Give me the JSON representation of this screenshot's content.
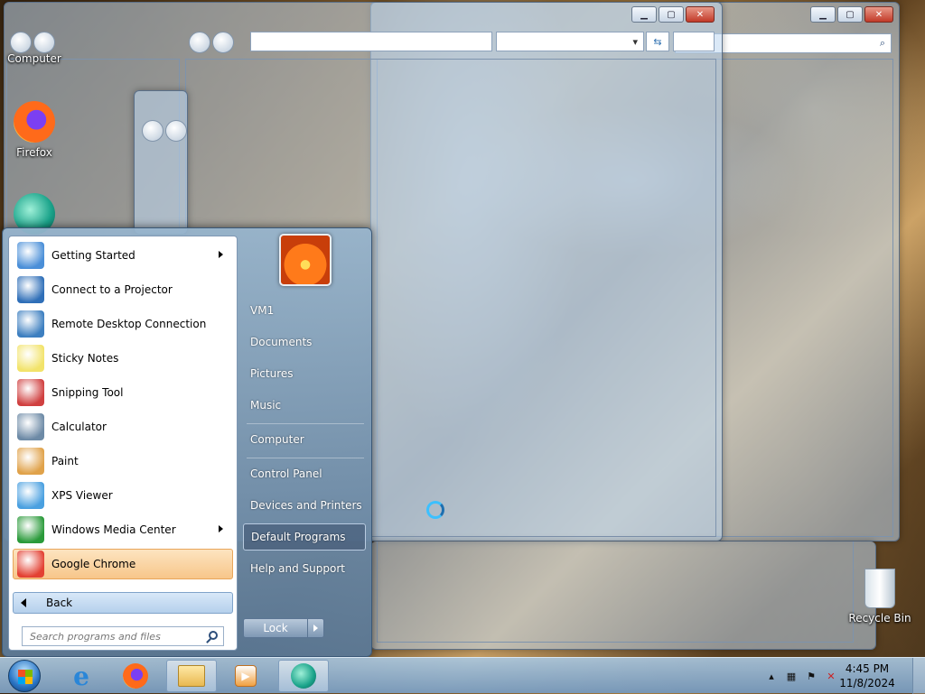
{
  "desktop": {
    "icons": [
      {
        "label": "Computer"
      },
      {
        "label": "Firefox"
      },
      {
        "label": "Recycle Bin"
      }
    ]
  },
  "start_menu": {
    "programs": [
      {
        "label": "Getting Started",
        "has_submenu": true,
        "icon": "getting-started-icon",
        "color": "#4a8fd8"
      },
      {
        "label": "Connect to a Projector",
        "has_submenu": false,
        "icon": "projector-icon",
        "color": "#2f6fb8"
      },
      {
        "label": "Remote Desktop Connection",
        "has_submenu": false,
        "icon": "remote-desktop-icon",
        "color": "#3d7fc0"
      },
      {
        "label": "Sticky Notes",
        "has_submenu": false,
        "icon": "sticky-notes-icon",
        "color": "#f2e36a"
      },
      {
        "label": "Snipping Tool",
        "has_submenu": false,
        "icon": "scissors-icon",
        "color": "#d04040"
      },
      {
        "label": "Calculator",
        "has_submenu": false,
        "icon": "calculator-icon",
        "color": "#6d8aa6"
      },
      {
        "label": "Paint",
        "has_submenu": false,
        "icon": "paint-palette-icon",
        "color": "#e0a24a"
      },
      {
        "label": "XPS Viewer",
        "has_submenu": false,
        "icon": "xps-viewer-icon",
        "color": "#4aa0e0"
      },
      {
        "label": "Windows Media Center",
        "has_submenu": true,
        "icon": "media-center-icon",
        "color": "#2a9a3a"
      },
      {
        "label": "Google Chrome",
        "has_submenu": false,
        "icon": "chrome-icon",
        "color": "#e34133",
        "highlighted": true
      }
    ],
    "back_label": "Back",
    "search_placeholder": "Search programs and files",
    "right_items": [
      {
        "label": "VM1"
      },
      {
        "label": "Documents"
      },
      {
        "label": "Pictures"
      },
      {
        "label": "Music"
      },
      {
        "label": "Computer"
      },
      {
        "label": "Control Panel"
      },
      {
        "label": "Devices and Printers"
      },
      {
        "label": "Default Programs",
        "highlighted": true
      },
      {
        "label": "Help and Support"
      }
    ],
    "lock_label": "Lock"
  },
  "taskbar": {
    "time": "4:45 PM",
    "date": "11/8/2024"
  }
}
